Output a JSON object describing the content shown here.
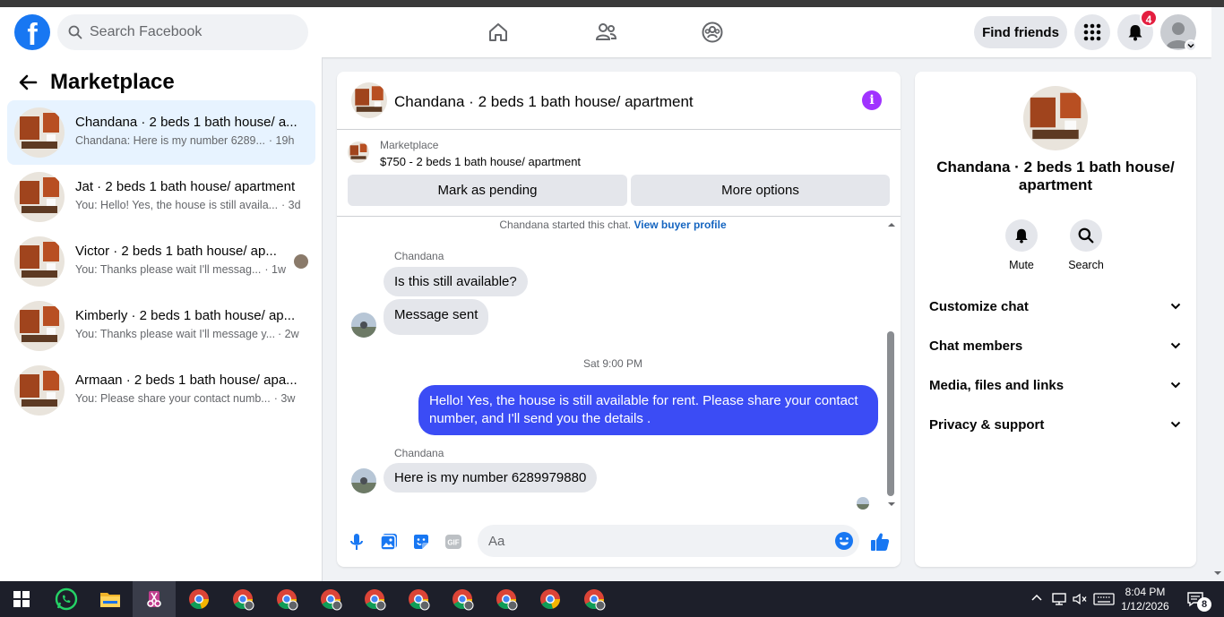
{
  "topbar": {
    "search_placeholder": "Search Facebook",
    "find_friends_label": "Find friends",
    "notification_count": "4",
    "logo_letter": "f"
  },
  "sidebar": {
    "title": "Marketplace",
    "conversations": [
      {
        "title": "Chandana · 2 beds 1 bath house/ a...",
        "preview": "Chandana: Here is my number 6289...",
        "time": "· 19h",
        "active": true
      },
      {
        "title": "Jat · 2 beds 1 bath house/ apartment",
        "preview": "You: Hello! Yes, the house is still availa...",
        "time": "· 3d",
        "active": false
      },
      {
        "title": "Victor · 2 beds 1 bath house/ ap...",
        "preview": "You: Thanks please wait I'll messag...",
        "time": "· 1w",
        "active": false
      },
      {
        "title": "Kimberly · 2 beds 1 bath house/ ap...",
        "preview": "You: Thanks please wait I'll message y...",
        "time": "· 2w",
        "active": false
      },
      {
        "title": "Armaan · 2 beds 1 bath house/ apa...",
        "preview": "You: Please share your contact numb...",
        "time": "· 3w",
        "active": false
      }
    ]
  },
  "chat": {
    "title": "Chandana · 2 beds 1 bath house/ apartment",
    "info_glyph": "i",
    "marketplace_label": "Marketplace",
    "listing": "$750 - 2 beds 1 bath house/ apartment",
    "mark_pending_label": "Mark as pending",
    "more_options_label": "More options",
    "started_text": "Chandana started this chat.",
    "view_buyer_label": "View buyer profile",
    "messages": {
      "sender1": "Chandana",
      "msg1": "Is this still available?",
      "msg2": "Message sent",
      "timestamp": "Sat 9:00 PM",
      "msg3": "Hello! Yes, the house is still available for rent. Please share your contact number, and I'll send you the details .",
      "sender2": "Chandana",
      "msg4": "Here is my number 6289979880"
    },
    "composer_placeholder": "Aa"
  },
  "details": {
    "title": "Chandana · 2 beds 1 bath house/ apartment",
    "mute_label": "Mute",
    "search_label": "Search",
    "rows": [
      "Customize chat",
      "Chat members",
      "Media, files and links",
      "Privacy & support"
    ]
  },
  "taskbar": {
    "time": "8:04 PM",
    "date": "1/12/2026",
    "notif_count": "8"
  },
  "colors": {
    "brand": "#1877f2",
    "outgoing_bubble": "#3b4cf5",
    "info_purple": "#a033ff",
    "badge_red": "#e41e3f"
  }
}
